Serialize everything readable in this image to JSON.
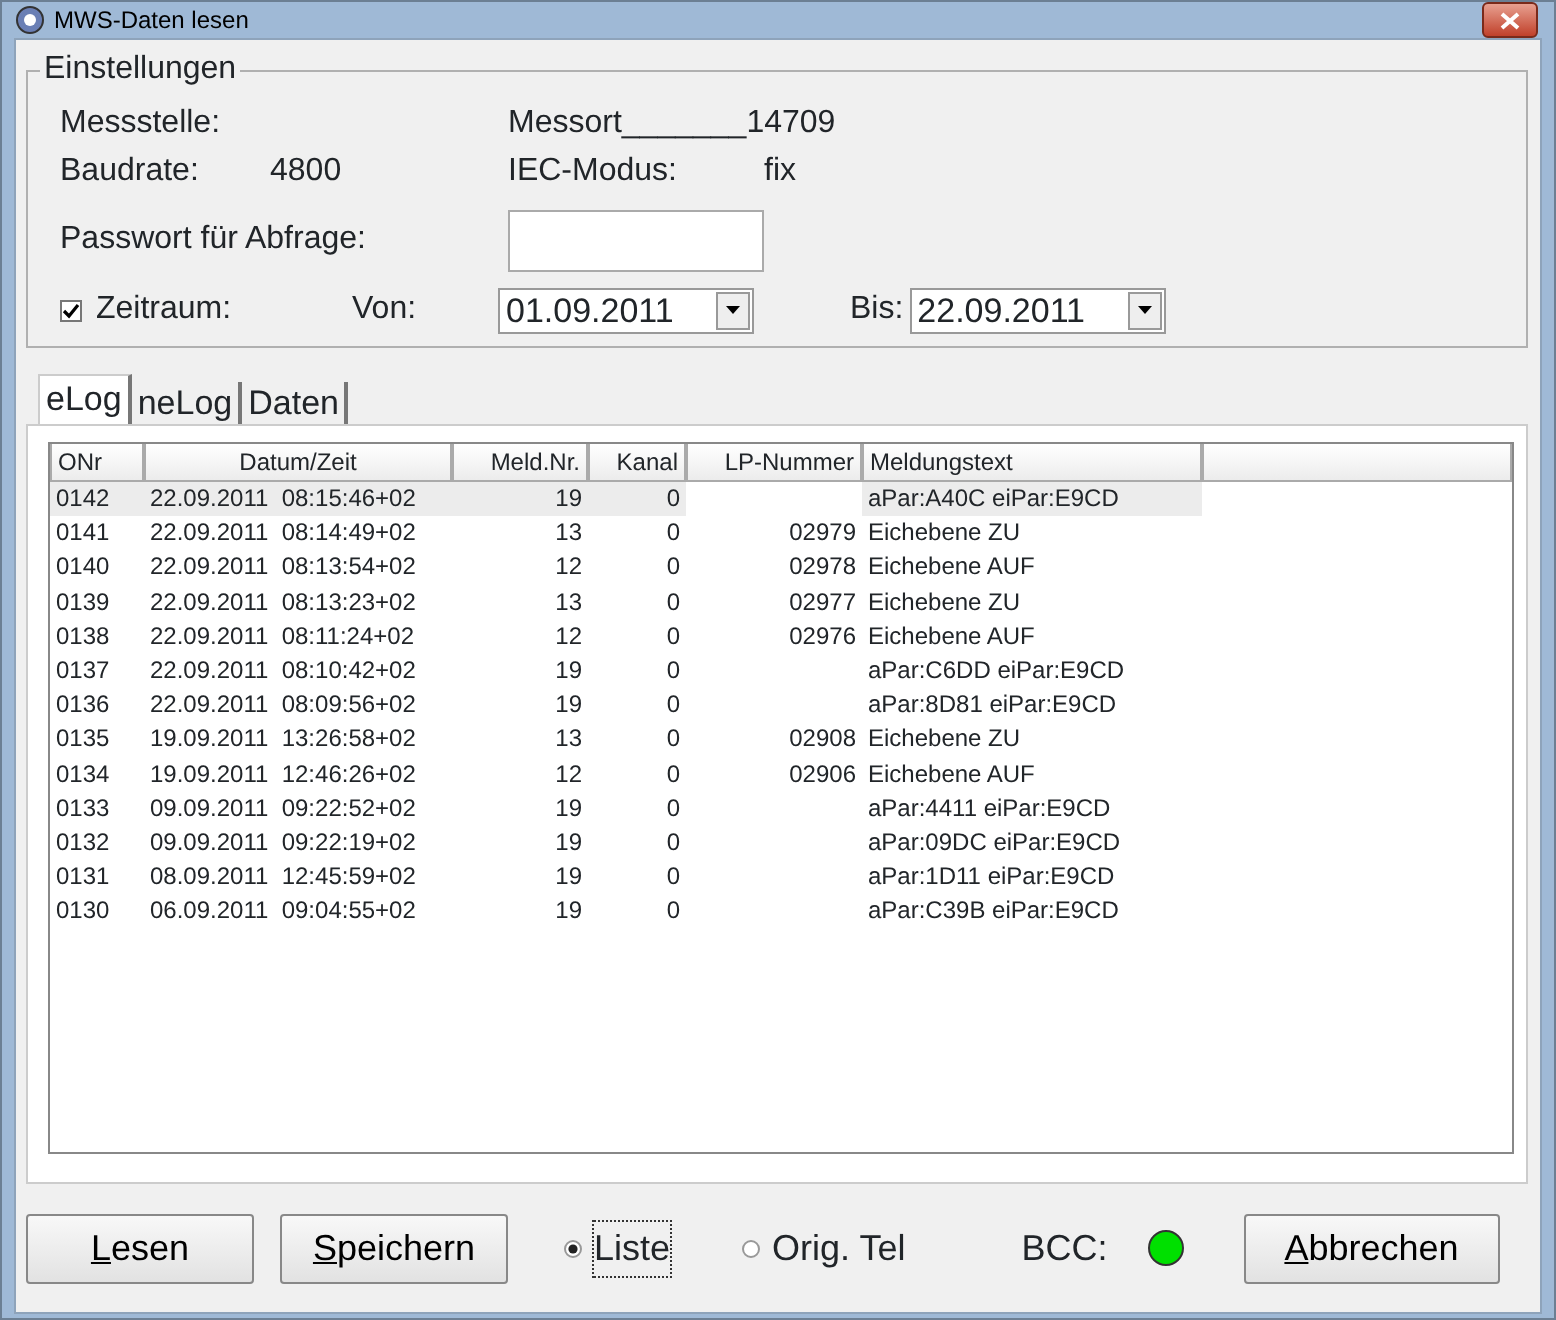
{
  "window": {
    "title": "MWS-Daten lesen"
  },
  "settings": {
    "title": "Einstellungen",
    "fields": [
      {
        "label": "Messstelle:",
        "value": "Messort_______14709"
      },
      {
        "label": "Baudrate:",
        "value": "4800"
      },
      {
        "label": "IEC-Modus:",
        "value": "fix"
      }
    ],
    "password": {
      "label": "Passwort für Abfrage:"
    },
    "period": {
      "label": "Zeitraum:",
      "checked": true,
      "from_label": "Von:",
      "from": "01.09.2011",
      "to_label": "Bis:",
      "to": "22.09.2011"
    }
  },
  "tabs": [
    {
      "label": "eLog",
      "selected": true
    },
    {
      "label": "neLog",
      "selected": false
    },
    {
      "label": "Daten",
      "selected": false
    }
  ],
  "table": {
    "columns": [
      "ONr",
      "Datum/Zeit",
      "Meld.Nr.",
      "Kanal",
      "LP-Nummer",
      "Meldungstext"
    ],
    "rows": [
      {
        "selected": true,
        "cells": [
          "0142",
          "22.09.2011  08:15:46+02",
          "19",
          "0",
          "",
          "aPar:A40C eiPar:E9CD"
        ]
      },
      {
        "selected": false,
        "cells": [
          "0141",
          "22.09.2011  08:14:49+02",
          "13",
          "0",
          "02979",
          "Eichebene ZU"
        ]
      },
      {
        "selected": false,
        "cells": [
          "0140",
          "22.09.2011  08:13:54+02",
          "12",
          "0",
          "02978",
          "Eichebene AUF"
        ]
      },
      {
        "selected": false,
        "cells": [
          "0139",
          "22.09.2011  08:13:23+02",
          "13",
          "0",
          "02977",
          "Eichebene ZU"
        ]
      },
      {
        "selected": false,
        "cells": [
          "0138",
          "22.09.2011  08:11:24+02",
          "12",
          "0",
          "02976",
          "Eichebene AUF"
        ]
      },
      {
        "selected": false,
        "cells": [
          "0137",
          "22.09.2011  08:10:42+02",
          "19",
          "0",
          "",
          "aPar:C6DD eiPar:E9CD"
        ]
      },
      {
        "selected": false,
        "cells": [
          "0136",
          "22.09.2011  08:09:56+02",
          "19",
          "0",
          "",
          "aPar:8D81 eiPar:E9CD"
        ]
      },
      {
        "selected": false,
        "cells": [
          "0135",
          "19.09.2011  13:26:58+02",
          "13",
          "0",
          "02908",
          "Eichebene ZU"
        ]
      },
      {
        "selected": false,
        "cells": [
          "0134",
          "19.09.2011  12:46:26+02",
          "12",
          "0",
          "02906",
          "Eichebene AUF"
        ]
      },
      {
        "selected": false,
        "cells": [
          "0133",
          "09.09.2011  09:22:52+02",
          "19",
          "0",
          "",
          "aPar:4411 eiPar:E9CD"
        ]
      },
      {
        "selected": false,
        "cells": [
          "0132",
          "09.09.2011  09:22:19+02",
          "19",
          "0",
          "",
          "aPar:09DC eiPar:E9CD"
        ]
      },
      {
        "selected": false,
        "cells": [
          "0131",
          "08.09.2011  12:45:59+02",
          "19",
          "0",
          "",
          "aPar:1D11 eiPar:E9CD"
        ]
      },
      {
        "selected": false,
        "cells": [
          "0130",
          "06.09.2011  09:04:55+02",
          "19",
          "0",
          "",
          "aPar:C39B eiPar:E9CD"
        ]
      }
    ]
  },
  "footer": {
    "buttons": [
      {
        "label": "Lesen",
        "mnemonic_first": true
      },
      {
        "label": "Speichern",
        "mnemonic_first": true
      }
    ],
    "modes": [
      {
        "label": "Liste",
        "selected": true
      },
      {
        "label": "Orig. Tel",
        "selected": false
      }
    ],
    "bcc": {
      "label": "BCC:",
      "color": "#00e000"
    },
    "cancel": {
      "label": "Abbrechen",
      "mnemonic_first": true
    }
  }
}
